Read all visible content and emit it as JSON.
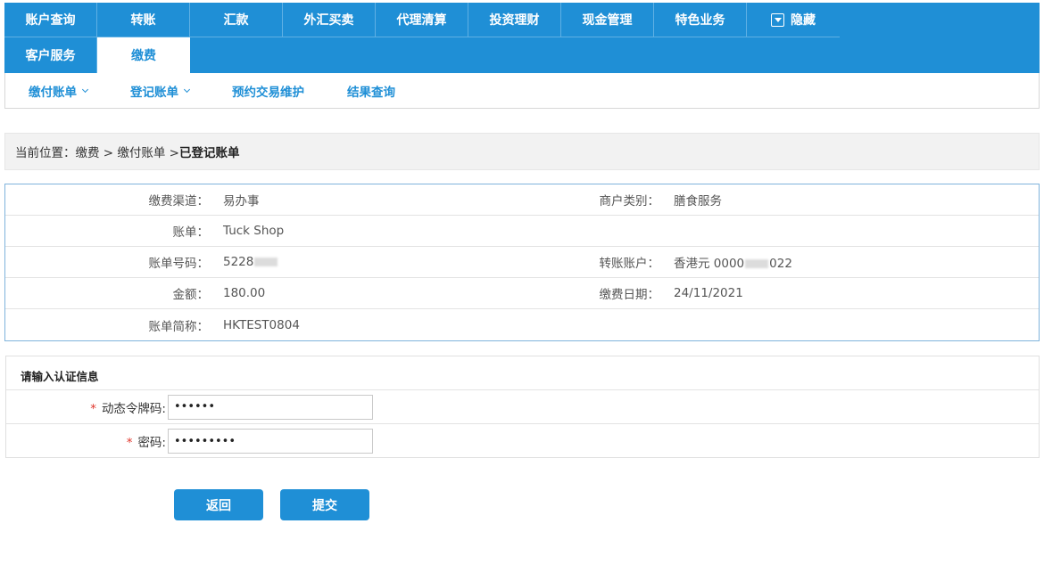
{
  "nav": {
    "row1": [
      "账户查询",
      "转账",
      "汇款",
      "外汇买卖",
      "代理清算",
      "投资理财",
      "现金管理",
      "特色业务"
    ],
    "hide_label": "隐藏",
    "row2": [
      "客户服务",
      "缴费"
    ],
    "active": "缴费"
  },
  "subnav": {
    "items": [
      "缴付账单",
      "登记账单",
      "预约交易维护",
      "结果查询"
    ]
  },
  "breadcrumb": {
    "prefix": "当前位置：缴费 > 缴付账单 > ",
    "current": "已登记账单"
  },
  "details": {
    "channel_label": "缴费渠道：",
    "channel_value": "易办事",
    "merchant_type_label": "商户类别：",
    "merchant_type_value": "膳食服务",
    "bill_label": "账单：",
    "bill_value": "Tuck Shop",
    "bill_no_label": "账单号码：",
    "bill_no_prefix": "5228",
    "transfer_account_label": "转账账户：",
    "transfer_account_prefix": "香港元 0000",
    "transfer_account_suffix": "022",
    "amount_label": "金额：",
    "amount_value": "180.00",
    "pay_date_label": "缴费日期：",
    "pay_date_value": "24/11/2021",
    "bill_short_label": "账单简称：",
    "bill_short_value": "HKTEST0804"
  },
  "auth": {
    "title": "请输入认证信息",
    "token_label": "动态令牌码:",
    "token_value": "••••••",
    "password_label": "密码:",
    "password_value": "•••••••••",
    "required_mark": "*"
  },
  "buttons": {
    "back": "返回",
    "submit": "提交"
  },
  "colors": {
    "primary": "#1f8fd6",
    "required": "#e0352b"
  }
}
